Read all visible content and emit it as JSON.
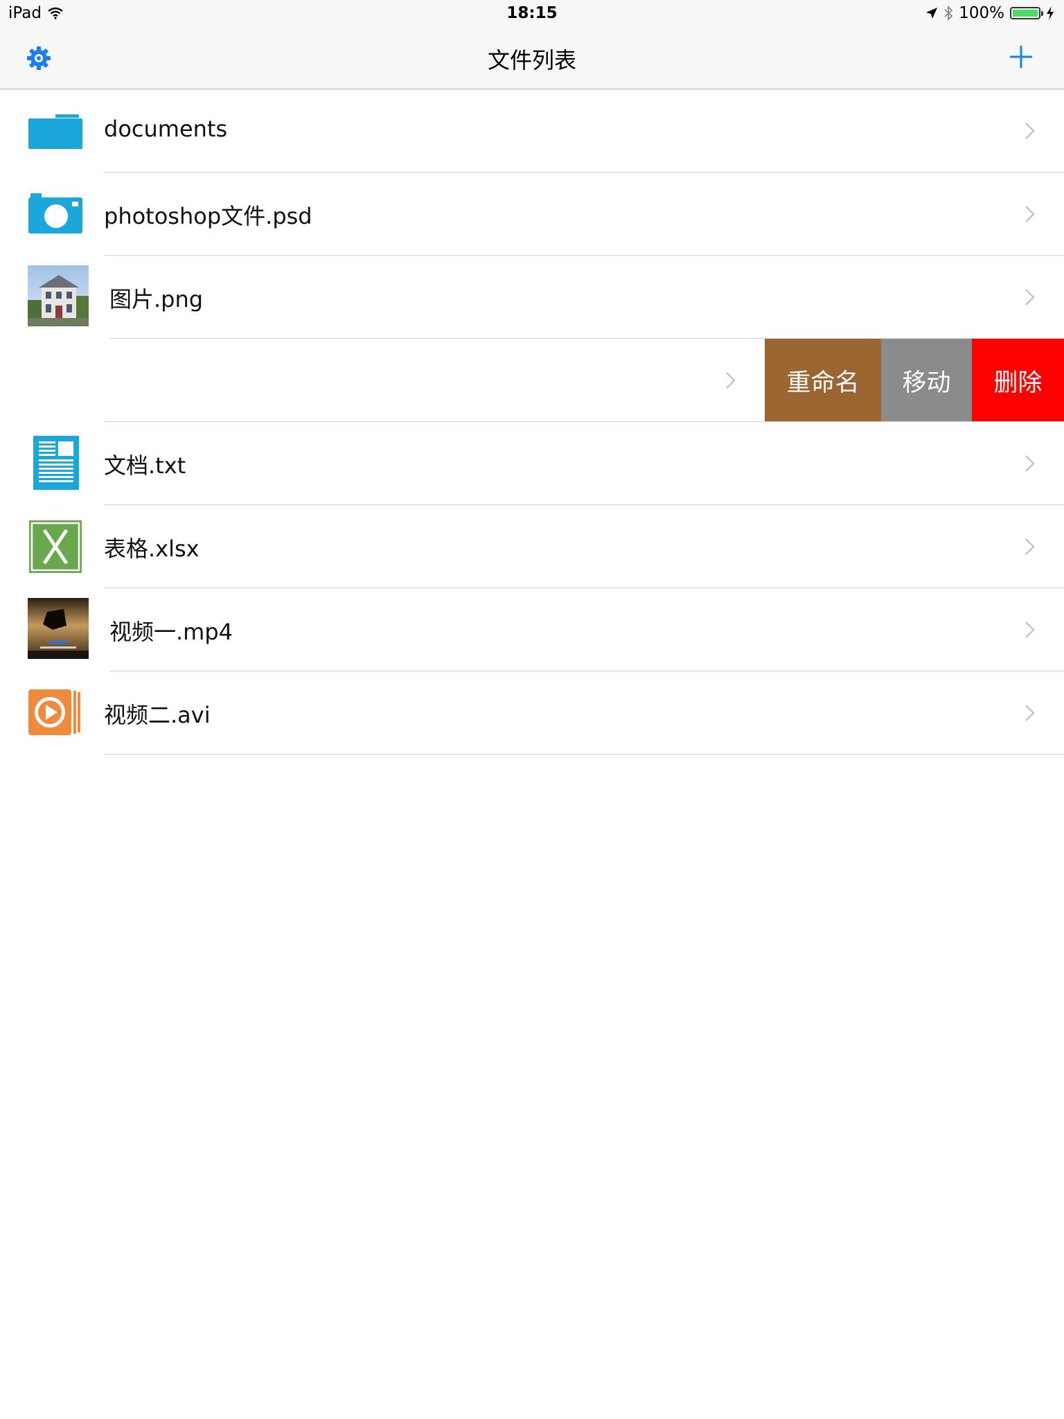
{
  "status_bar": {
    "carrier": "iPad",
    "time": "18:15",
    "battery_percent": "100%",
    "battery_level": 1.0,
    "icons": [
      "wifi-icon",
      "location-arrow-icon",
      "bluetooth-icon",
      "battery-icon",
      "charging-bolt-icon"
    ]
  },
  "navbar": {
    "title": "文件列表",
    "left_icon": "gear-icon",
    "right_icon": "plus-icon",
    "tint_color": "#1a7ef7"
  },
  "files": [
    {
      "name": "documents",
      "icon": "folder-icon"
    },
    {
      "name": "photoshop文件.psd",
      "icon": "camera-icon"
    },
    {
      "name": "图片.png",
      "icon": "image-thumbnail"
    },
    {
      "name": "",
      "icon": "",
      "swiped": true
    },
    {
      "name": "文档.txt",
      "icon": "document-icon"
    },
    {
      "name": "表格.xlsx",
      "icon": "excel-icon"
    },
    {
      "name": "视频一.mp4",
      "icon": "video-thumbnail"
    },
    {
      "name": "视频二.avi",
      "icon": "play-file-icon"
    }
  ],
  "swipe_actions": {
    "rename": "重命名",
    "move": "移动",
    "delete": "删除",
    "colors": {
      "rename": "#9b6532",
      "move": "#8a8a8a",
      "delete": "#fe0000"
    }
  },
  "icon_color": "#1aa8dc"
}
